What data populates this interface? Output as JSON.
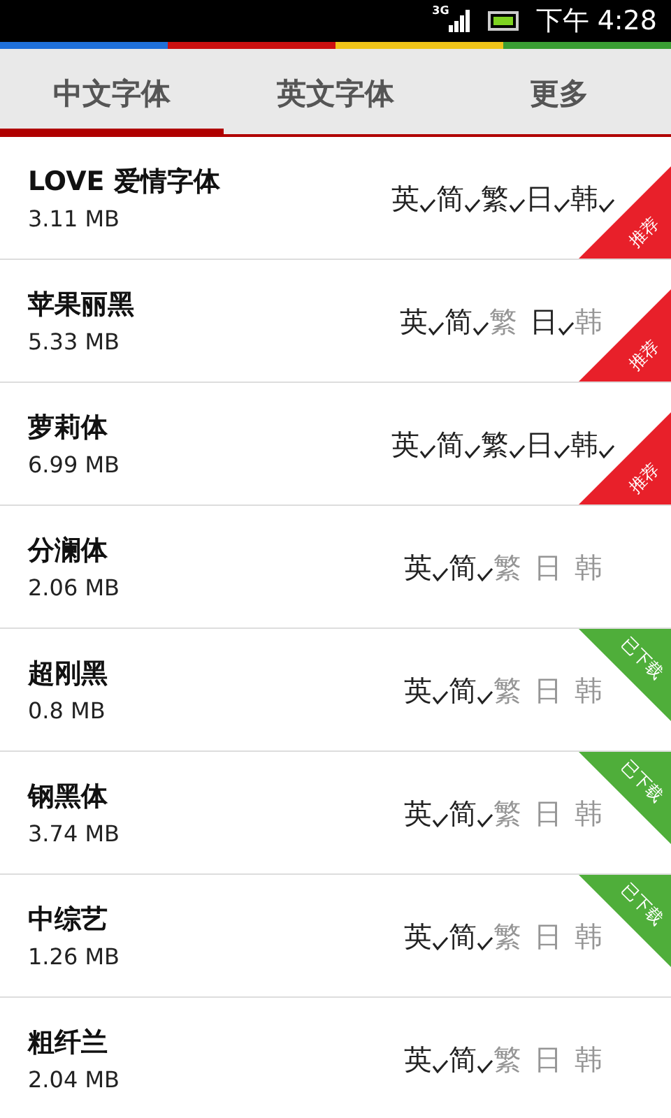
{
  "status_bar": {
    "network": "3G",
    "time": "下午 4:28"
  },
  "tabs": [
    {
      "label": "中文字体",
      "selected": true
    },
    {
      "label": "英文字体",
      "selected": false
    },
    {
      "label": "更多",
      "selected": false
    }
  ],
  "fonts": [
    {
      "name": "LOVE 爱情字体",
      "size": "3.11 MB",
      "badge": {
        "kind": "recommended",
        "label": "推荐"
      },
      "languages": [
        {
          "label": "英",
          "supported": true
        },
        {
          "label": "简",
          "supported": true
        },
        {
          "label": "繁",
          "supported": true
        },
        {
          "label": "日",
          "supported": true
        },
        {
          "label": "韩",
          "supported": true
        }
      ]
    },
    {
      "name": "苹果丽黑",
      "size": "5.33 MB",
      "badge": {
        "kind": "recommended",
        "label": "推荐"
      },
      "languages": [
        {
          "label": "英",
          "supported": true
        },
        {
          "label": "简",
          "supported": true
        },
        {
          "label": "繁",
          "supported": false
        },
        {
          "label": "日",
          "supported": true
        },
        {
          "label": "韩",
          "supported": false
        }
      ]
    },
    {
      "name": "萝莉体",
      "size": "6.99 MB",
      "badge": {
        "kind": "recommended",
        "label": "推荐"
      },
      "languages": [
        {
          "label": "英",
          "supported": true
        },
        {
          "label": "简",
          "supported": true
        },
        {
          "label": "繁",
          "supported": true
        },
        {
          "label": "日",
          "supported": true
        },
        {
          "label": "韩",
          "supported": true
        }
      ]
    },
    {
      "name": "分澜体",
      "size": "2.06 MB",
      "languages": [
        {
          "label": "英",
          "supported": true
        },
        {
          "label": "简",
          "supported": true
        },
        {
          "label": "繁",
          "supported": false
        },
        {
          "label": "日",
          "supported": false
        },
        {
          "label": "韩",
          "supported": false
        }
      ]
    },
    {
      "name": "超刚黑",
      "size": "0.8 MB",
      "badge": {
        "kind": "downloaded",
        "label": "已下载"
      },
      "languages": [
        {
          "label": "英",
          "supported": true
        },
        {
          "label": "简",
          "supported": true
        },
        {
          "label": "繁",
          "supported": false
        },
        {
          "label": "日",
          "supported": false
        },
        {
          "label": "韩",
          "supported": false
        }
      ]
    },
    {
      "name": "钢黑体",
      "size": "3.74 MB",
      "badge": {
        "kind": "downloaded",
        "label": "已下载"
      },
      "languages": [
        {
          "label": "英",
          "supported": true
        },
        {
          "label": "简",
          "supported": true
        },
        {
          "label": "繁",
          "supported": false
        },
        {
          "label": "日",
          "supported": false
        },
        {
          "label": "韩",
          "supported": false
        }
      ]
    },
    {
      "name": "中综艺",
      "size": "1.26 MB",
      "badge": {
        "kind": "downloaded",
        "label": "已下载"
      },
      "languages": [
        {
          "label": "英",
          "supported": true
        },
        {
          "label": "简",
          "supported": true
        },
        {
          "label": "繁",
          "supported": false
        },
        {
          "label": "日",
          "supported": false
        },
        {
          "label": "韩",
          "supported": false
        }
      ]
    },
    {
      "name": "粗纤兰",
      "size": "2.04 MB",
      "languages": [
        {
          "label": "英",
          "supported": true
        },
        {
          "label": "简",
          "supported": true
        },
        {
          "label": "繁",
          "supported": false
        },
        {
          "label": "日",
          "supported": false
        },
        {
          "label": "韩",
          "supported": false
        }
      ]
    }
  ]
}
